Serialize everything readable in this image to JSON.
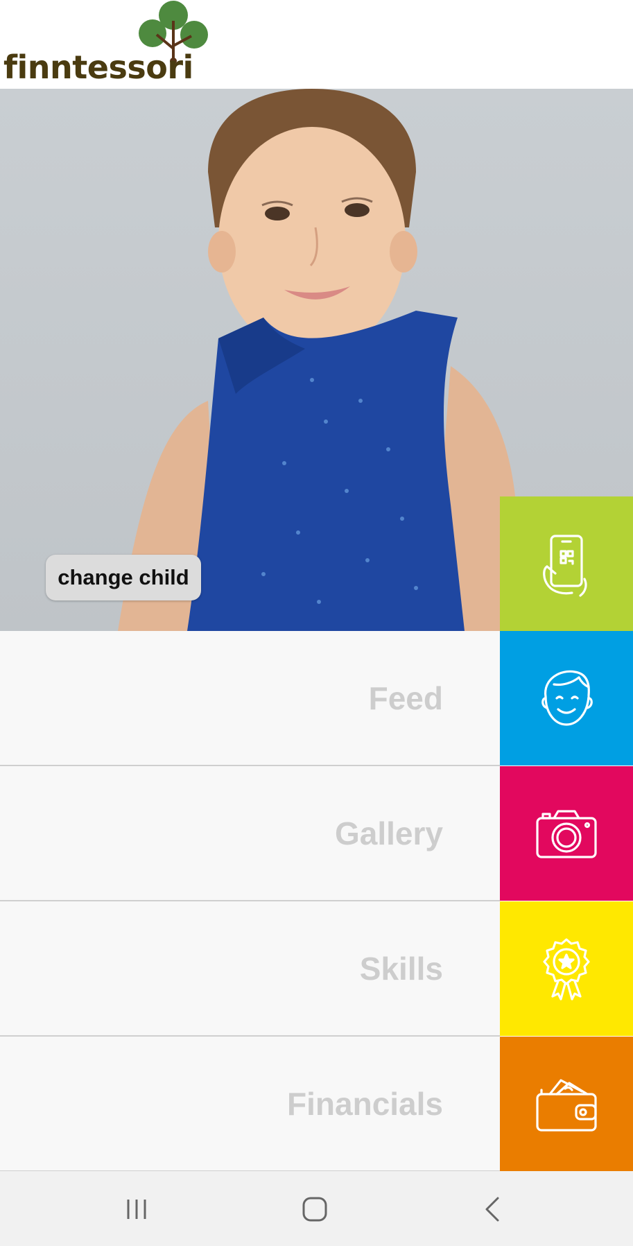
{
  "app": {
    "logo_text": "finntessori"
  },
  "hero": {
    "change_child_label": "change child"
  },
  "menu": {
    "items": [
      {
        "label": "Feed",
        "icon": "child-face-icon",
        "color": "#009fe3"
      },
      {
        "label": "Gallery",
        "icon": "camera-icon",
        "color": "#e2085e"
      },
      {
        "label": "Skills",
        "icon": "award-badge-icon",
        "color": "#ffe800"
      },
      {
        "label": "Financials",
        "icon": "wallet-icon",
        "color": "#ea7d00"
      }
    ],
    "top_tile": {
      "icon": "phone-scan-icon",
      "color": "#b3d235"
    }
  },
  "navbar": {
    "recents_icon": "recent-apps-icon",
    "home_icon": "home-icon",
    "back_icon": "back-icon"
  }
}
